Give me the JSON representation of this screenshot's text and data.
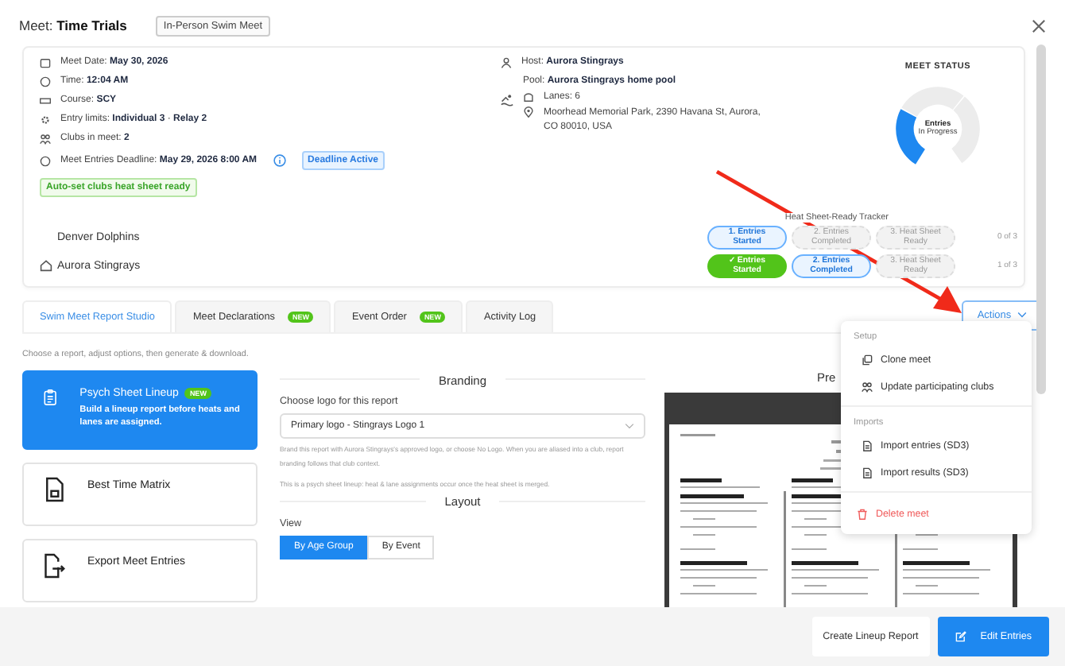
{
  "modal": {
    "title_label": "Meet:",
    "title": "Time Trials",
    "meet_type": "In-Person Swim Meet"
  },
  "details": [
    {
      "kind": "date",
      "text": "Meet Date: **May 30, 2026**"
    },
    {
      "kind": "time",
      "text": "Time: **12:04 AM**"
    },
    {
      "kind": "course",
      "text": "Course: **SCY**"
    },
    {
      "kind": "limits",
      "text": "Entry limits: **Individual 3**  · **Relay 2**"
    },
    {
      "kind": "clubs",
      "text": "Clubs in meet: **2**"
    },
    {
      "kind": "deadline",
      "text": "Meet Entries Deadline: **May 29, 2026 8:00 AM**"
    }
  ],
  "deadline_badge": "Deadline Active",
  "auto_badge": "Auto-set clubs heat sheet ready",
  "venue": {
    "host": "Host: **Aurora Stingrays**",
    "pool": "Pool: **Aurora Stingrays home pool**",
    "lanes": "Lanes: 6",
    "address": "Moorhead Memorial Park, 2390 Havana St, Aurora, CO 80010, USA"
  },
  "status": {
    "title": "MEET STATUS",
    "center": [
      "Entries",
      "In Progress"
    ]
  },
  "tracker": {
    "title": "Heat Sheet-Ready Tracker",
    "clubs": [
      {
        "name": "Denver Dolphins",
        "home": false,
        "count": "0 of 3",
        "steps": [
          {
            "label": "1. Entries Started",
            "kind": "current"
          },
          {
            "label": "2. Entries Completed",
            "kind": "pending"
          },
          {
            "label": "3. Heat Sheet Ready",
            "kind": "pending"
          }
        ]
      },
      {
        "name": "Aurora Stingrays",
        "home": true,
        "count": "1 of 3",
        "steps": [
          {
            "label": "✓ Entries Started",
            "kind": "done"
          },
          {
            "label": "2. Entries Completed",
            "kind": "current"
          },
          {
            "label": "3. Heat Sheet Ready",
            "kind": "pending"
          }
        ]
      }
    ]
  },
  "tabs": [
    {
      "label": "Swim Meet Report Studio",
      "selected": true
    },
    {
      "label": "Meet Declarations",
      "selected": false,
      "badge": "NEW"
    },
    {
      "label": "Event Order",
      "selected": false,
      "badge": "NEW"
    },
    {
      "label": "Activity Log",
      "selected": false
    }
  ],
  "actions_button": "Actions",
  "hint": "Choose a report, adjust options, then generate & download.",
  "reports": [
    {
      "kind": "lineup",
      "title": "Psych Sheet Lineup",
      "badge": "NEW",
      "description": "Build a lineup report before heats and lanes are assigned.",
      "selected": true
    },
    {
      "kind": "matrix",
      "title": "Best Time Matrix",
      "selected": false
    },
    {
      "kind": "export",
      "title": "Export Meet Entries",
      "selected": false
    }
  ],
  "branding": {
    "heading": "Branding",
    "logo_label": "Choose logo for this report",
    "logo_value": "Primary logo - Stingrays Logo 1",
    "help": "Brand this report with Aurora Stingrays's approved logo, or choose No Logo. When you are aliased into a club, report branding follows that club context.",
    "note": "This is a psych sheet lineup: heat & lane assignments occur once the heat sheet is merged."
  },
  "layout": {
    "heading": "Layout",
    "view_label": "View",
    "views": [
      {
        "label": "By Age Group",
        "selected": true
      },
      {
        "label": "By Event",
        "selected": false
      }
    ]
  },
  "preview": {
    "heading": "Pre"
  },
  "menu": {
    "sections": [
      {
        "title": "Setup",
        "items": [
          {
            "label": "Clone meet"
          },
          {
            "label": "Update participating clubs"
          }
        ]
      },
      {
        "title": "Imports",
        "items": [
          {
            "label": "Import entries (SD3)"
          },
          {
            "label": "Import results (SD3)"
          }
        ]
      }
    ],
    "delete": "Delete meet"
  },
  "footer": {
    "buttons": [
      {
        "label": "Create Lineup Report",
        "kind": "secondary"
      },
      {
        "label": "Edit Entries",
        "kind": "primary"
      }
    ]
  }
}
